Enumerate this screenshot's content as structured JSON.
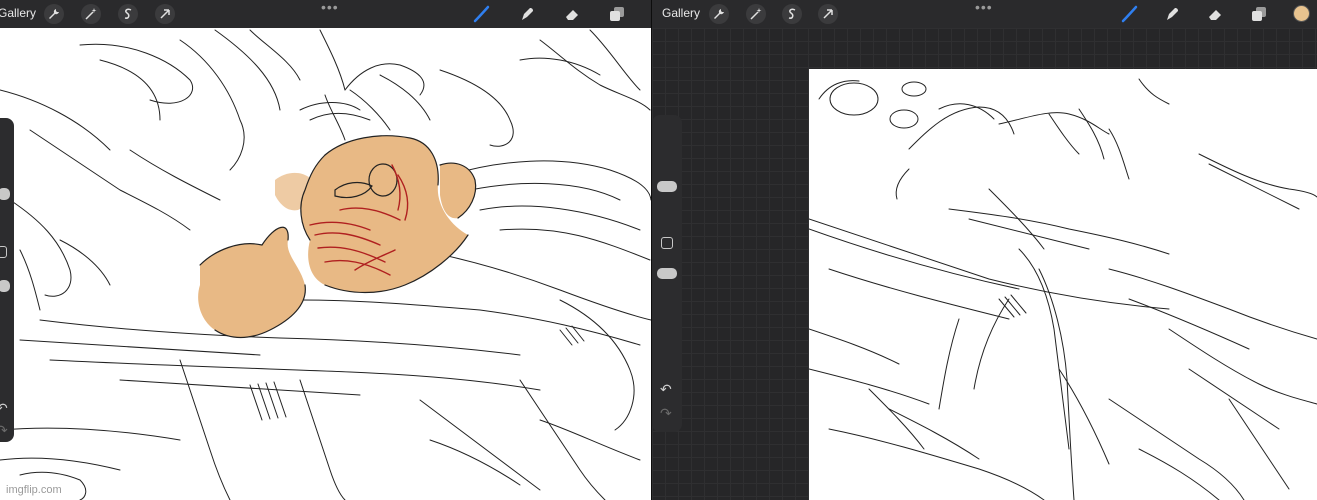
{
  "left_app": {
    "gallery_label": "Gallery",
    "more_label": "•••",
    "toolbar_icons": [
      "wrench-icon",
      "magic-wand-icon",
      "selection-s-icon",
      "arrow-cursor-icon"
    ],
    "right_tools": [
      "brush-icon",
      "smudge-icon",
      "eraser-icon",
      "layers-icon"
    ],
    "accent": "#2f7ff0",
    "skin_color": "#e8b985",
    "blood_color": "#b02020",
    "watermark": "imgflip.com"
  },
  "right_app": {
    "gallery_label": "Gallery",
    "more_label": "•••",
    "toolbar_icons": [
      "wrench-icon",
      "magic-wand-icon",
      "selection-s-icon",
      "arrow-cursor-icon"
    ],
    "right_tools": [
      "brush-icon",
      "smudge-icon",
      "eraser-icon",
      "layers-icon"
    ],
    "accent": "#2f7ff0",
    "current_color": "#e8c38f",
    "sidebar_icons": [
      "undo-icon",
      "redo-icon"
    ]
  }
}
